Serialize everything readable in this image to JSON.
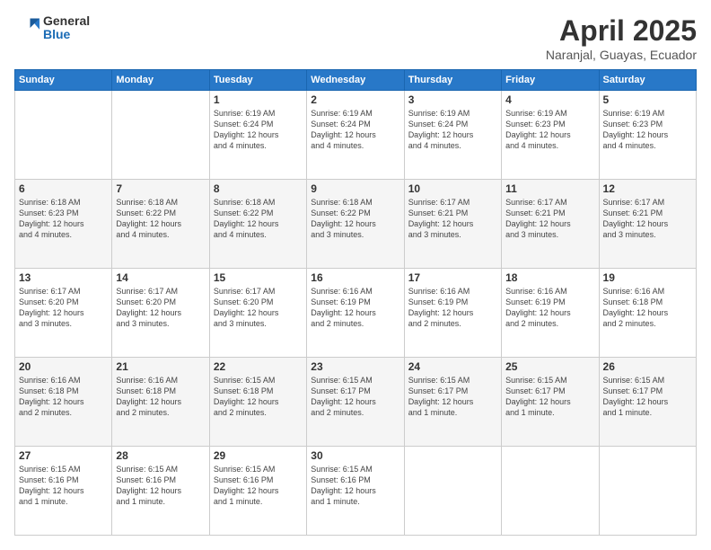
{
  "header": {
    "logo": {
      "general": "General",
      "blue": "Blue"
    },
    "title": "April 2025",
    "location": "Naranjal, Guayas, Ecuador"
  },
  "days_of_week": [
    "Sunday",
    "Monday",
    "Tuesday",
    "Wednesday",
    "Thursday",
    "Friday",
    "Saturday"
  ],
  "weeks": [
    [
      {
        "day": "",
        "info": ""
      },
      {
        "day": "",
        "info": ""
      },
      {
        "day": "1",
        "info": "Sunrise: 6:19 AM\nSunset: 6:24 PM\nDaylight: 12 hours\nand 4 minutes."
      },
      {
        "day": "2",
        "info": "Sunrise: 6:19 AM\nSunset: 6:24 PM\nDaylight: 12 hours\nand 4 minutes."
      },
      {
        "day": "3",
        "info": "Sunrise: 6:19 AM\nSunset: 6:24 PM\nDaylight: 12 hours\nand 4 minutes."
      },
      {
        "day": "4",
        "info": "Sunrise: 6:19 AM\nSunset: 6:23 PM\nDaylight: 12 hours\nand 4 minutes."
      },
      {
        "day": "5",
        "info": "Sunrise: 6:19 AM\nSunset: 6:23 PM\nDaylight: 12 hours\nand 4 minutes."
      }
    ],
    [
      {
        "day": "6",
        "info": "Sunrise: 6:18 AM\nSunset: 6:23 PM\nDaylight: 12 hours\nand 4 minutes."
      },
      {
        "day": "7",
        "info": "Sunrise: 6:18 AM\nSunset: 6:22 PM\nDaylight: 12 hours\nand 4 minutes."
      },
      {
        "day": "8",
        "info": "Sunrise: 6:18 AM\nSunset: 6:22 PM\nDaylight: 12 hours\nand 4 minutes."
      },
      {
        "day": "9",
        "info": "Sunrise: 6:18 AM\nSunset: 6:22 PM\nDaylight: 12 hours\nand 3 minutes."
      },
      {
        "day": "10",
        "info": "Sunrise: 6:17 AM\nSunset: 6:21 PM\nDaylight: 12 hours\nand 3 minutes."
      },
      {
        "day": "11",
        "info": "Sunrise: 6:17 AM\nSunset: 6:21 PM\nDaylight: 12 hours\nand 3 minutes."
      },
      {
        "day": "12",
        "info": "Sunrise: 6:17 AM\nSunset: 6:21 PM\nDaylight: 12 hours\nand 3 minutes."
      }
    ],
    [
      {
        "day": "13",
        "info": "Sunrise: 6:17 AM\nSunset: 6:20 PM\nDaylight: 12 hours\nand 3 minutes."
      },
      {
        "day": "14",
        "info": "Sunrise: 6:17 AM\nSunset: 6:20 PM\nDaylight: 12 hours\nand 3 minutes."
      },
      {
        "day": "15",
        "info": "Sunrise: 6:17 AM\nSunset: 6:20 PM\nDaylight: 12 hours\nand 3 minutes."
      },
      {
        "day": "16",
        "info": "Sunrise: 6:16 AM\nSunset: 6:19 PM\nDaylight: 12 hours\nand 2 minutes."
      },
      {
        "day": "17",
        "info": "Sunrise: 6:16 AM\nSunset: 6:19 PM\nDaylight: 12 hours\nand 2 minutes."
      },
      {
        "day": "18",
        "info": "Sunrise: 6:16 AM\nSunset: 6:19 PM\nDaylight: 12 hours\nand 2 minutes."
      },
      {
        "day": "19",
        "info": "Sunrise: 6:16 AM\nSunset: 6:18 PM\nDaylight: 12 hours\nand 2 minutes."
      }
    ],
    [
      {
        "day": "20",
        "info": "Sunrise: 6:16 AM\nSunset: 6:18 PM\nDaylight: 12 hours\nand 2 minutes."
      },
      {
        "day": "21",
        "info": "Sunrise: 6:16 AM\nSunset: 6:18 PM\nDaylight: 12 hours\nand 2 minutes."
      },
      {
        "day": "22",
        "info": "Sunrise: 6:15 AM\nSunset: 6:18 PM\nDaylight: 12 hours\nand 2 minutes."
      },
      {
        "day": "23",
        "info": "Sunrise: 6:15 AM\nSunset: 6:17 PM\nDaylight: 12 hours\nand 2 minutes."
      },
      {
        "day": "24",
        "info": "Sunrise: 6:15 AM\nSunset: 6:17 PM\nDaylight: 12 hours\nand 1 minute."
      },
      {
        "day": "25",
        "info": "Sunrise: 6:15 AM\nSunset: 6:17 PM\nDaylight: 12 hours\nand 1 minute."
      },
      {
        "day": "26",
        "info": "Sunrise: 6:15 AM\nSunset: 6:17 PM\nDaylight: 12 hours\nand 1 minute."
      }
    ],
    [
      {
        "day": "27",
        "info": "Sunrise: 6:15 AM\nSunset: 6:16 PM\nDaylight: 12 hours\nand 1 minute."
      },
      {
        "day": "28",
        "info": "Sunrise: 6:15 AM\nSunset: 6:16 PM\nDaylight: 12 hours\nand 1 minute."
      },
      {
        "day": "29",
        "info": "Sunrise: 6:15 AM\nSunset: 6:16 PM\nDaylight: 12 hours\nand 1 minute."
      },
      {
        "day": "30",
        "info": "Sunrise: 6:15 AM\nSunset: 6:16 PM\nDaylight: 12 hours\nand 1 minute."
      },
      {
        "day": "",
        "info": ""
      },
      {
        "day": "",
        "info": ""
      },
      {
        "day": "",
        "info": ""
      }
    ]
  ]
}
